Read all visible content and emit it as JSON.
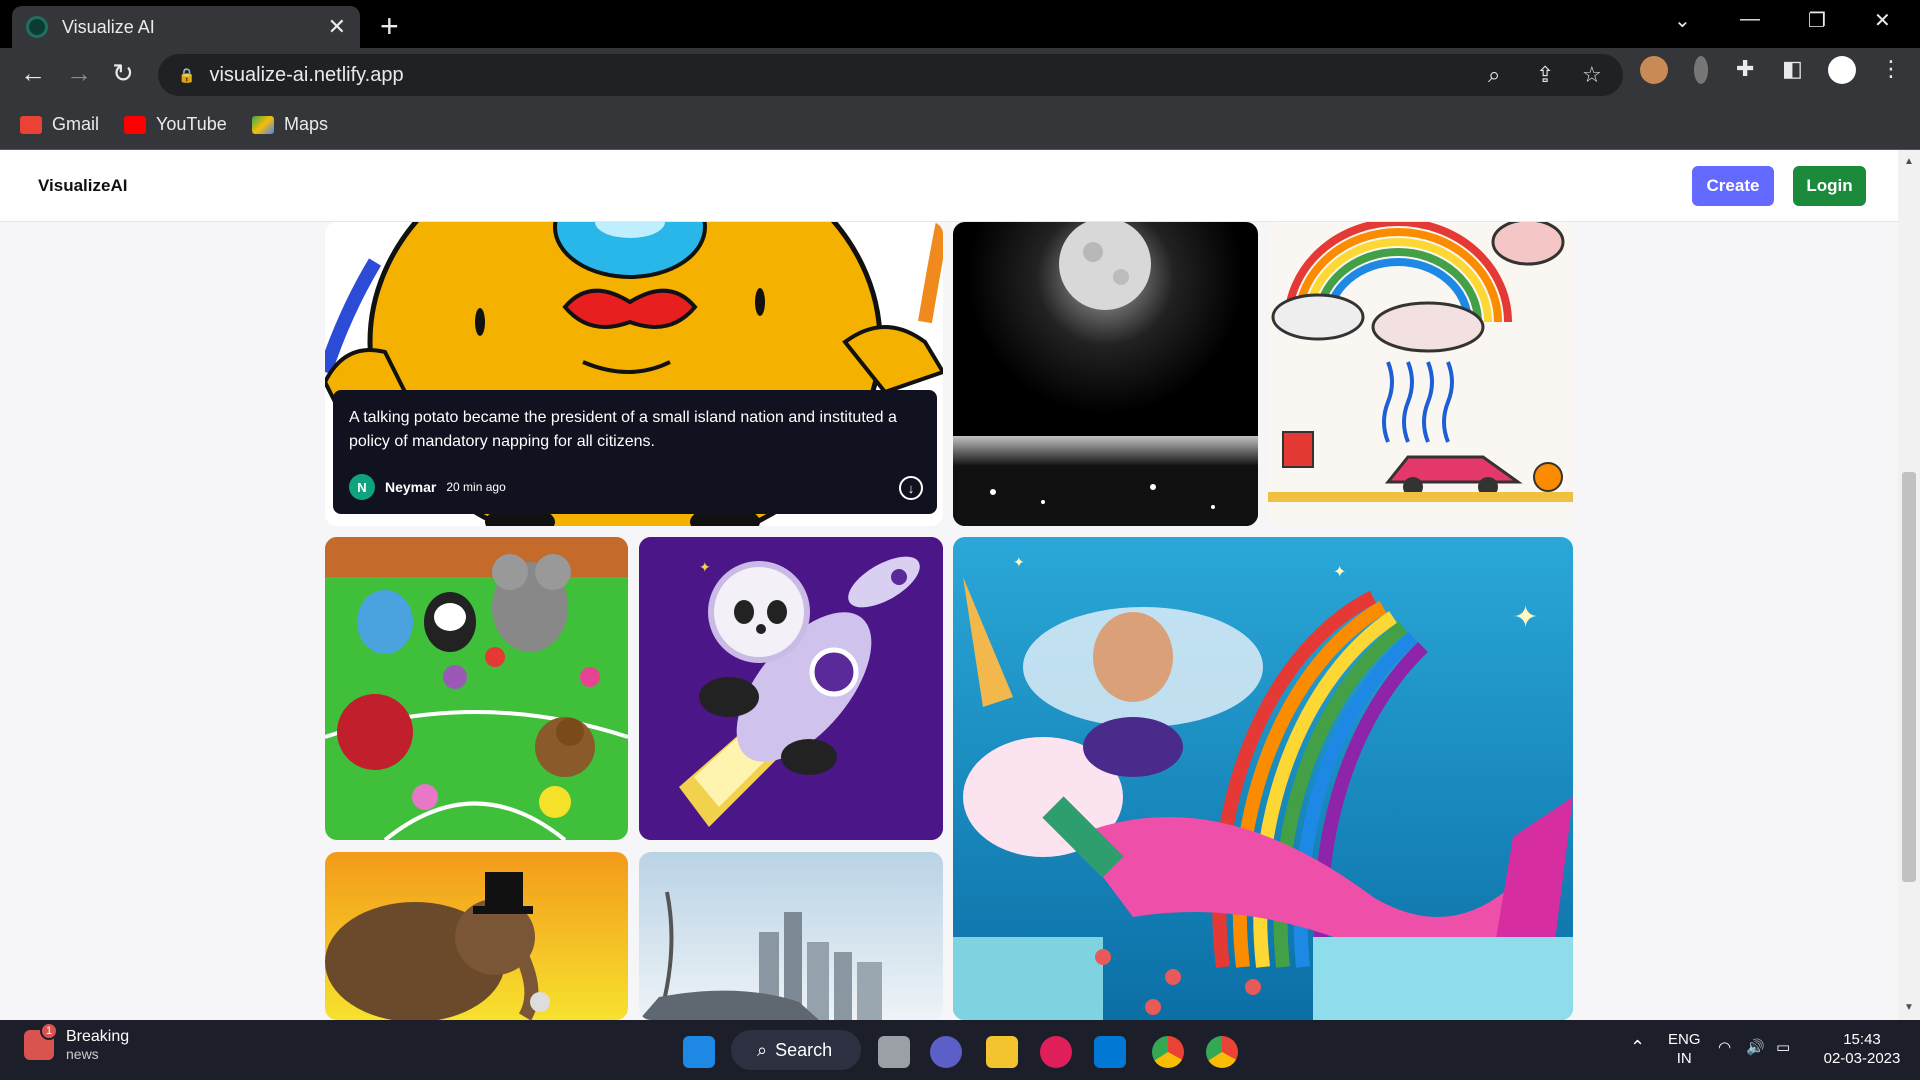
{
  "browser": {
    "tab_title": "Visualize AI",
    "tab_close": "✕",
    "new_tab": "+",
    "url": "visualize-ai.netlify.app",
    "bookmarks": [
      {
        "label": "Gmail",
        "color": "#ea4335"
      },
      {
        "label": "YouTube",
        "color": "#ff0000"
      },
      {
        "label": "Maps",
        "color": "#34a853"
      }
    ]
  },
  "header": {
    "logo": "VisualizeAI",
    "create_label": "Create",
    "login_label": "Login"
  },
  "gallery": {
    "featured": {
      "prompt": "A talking potato became the president of a small island nation and instituted a policy of mandatory napping for all citizens.",
      "author_initial": "N",
      "author": "Neymar",
      "time": "20 min ago"
    }
  },
  "taskbar": {
    "news_title": "Breaking",
    "news_sub": "news",
    "news_badge": "1",
    "search_label": "Search",
    "lang_top": "ENG",
    "lang_bottom": "IN",
    "time": "15:43",
    "date": "02-03-2023"
  },
  "colors": {
    "create": "#6469ff",
    "login": "#1b8a3a"
  }
}
